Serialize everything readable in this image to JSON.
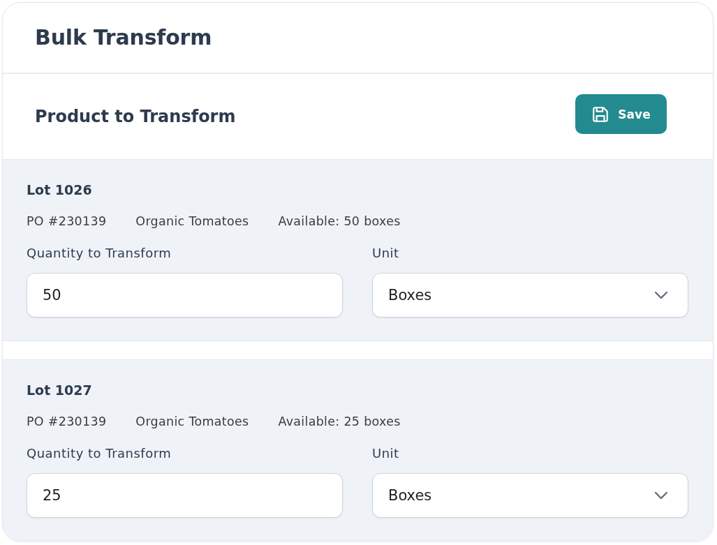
{
  "header": {
    "title": "Bulk Transform"
  },
  "section": {
    "title": "Product to Transform",
    "save_button": {
      "label": "Save"
    }
  },
  "lots": [
    {
      "title": "Lot 1026",
      "po": "PO #230139",
      "product": "Organic Tomatoes",
      "available": "Available: 50 boxes",
      "quantity": {
        "label": "Quantity to Transform",
        "value": "50"
      },
      "unit": {
        "label": "Unit",
        "value": "Boxes"
      }
    },
    {
      "title": "Lot 1027",
      "po": "PO #230139",
      "product": "Organic Tomatoes",
      "available": "Available: 25 boxes",
      "quantity": {
        "label": "Quantity to Transform",
        "value": "25"
      },
      "unit": {
        "label": "Unit",
        "value": "Boxes"
      }
    }
  ]
}
